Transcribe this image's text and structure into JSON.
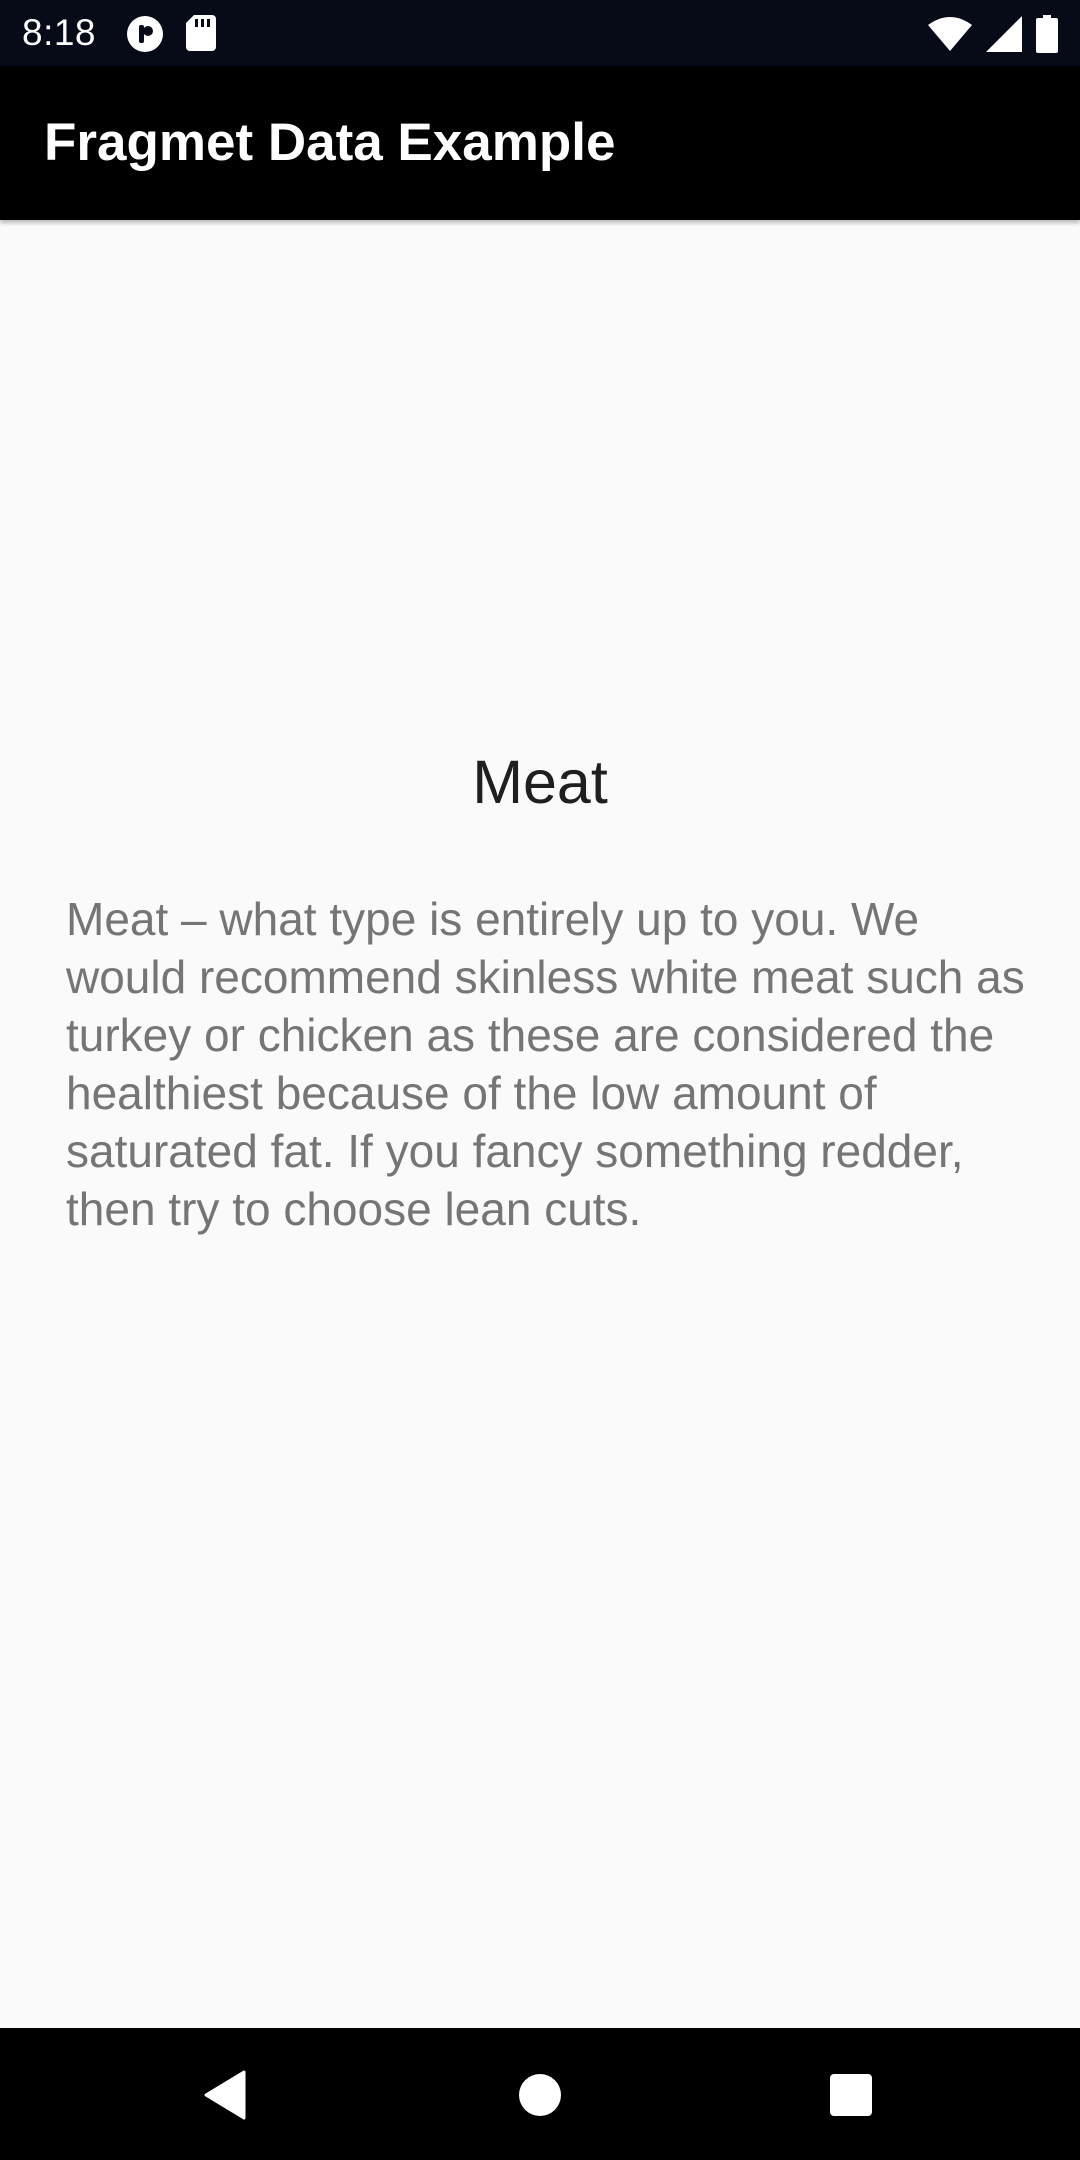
{
  "status_bar": {
    "time": "8:18",
    "icons_left": [
      "data-saver-icon",
      "sd-card-icon"
    ],
    "icons_right": [
      "wifi-icon",
      "cellular-signal-icon",
      "battery-icon"
    ]
  },
  "app_bar": {
    "title": "Fragmet Data Example"
  },
  "content": {
    "heading": "Meat",
    "description": "Meat – what type is entirely up to you. We would recommend skinless white meat such as turkey or chicken as these are considered the healthiest because of the low amount of saturated fat. If you fancy something redder, then try to choose lean cuts."
  },
  "nav_bar": {
    "buttons": [
      "back-icon",
      "home-icon",
      "recents-icon"
    ]
  },
  "colors": {
    "status_bar_bg": "#070a17",
    "app_bar_bg": "#000000",
    "page_bg": "#fafafa",
    "heading_text": "#1f1f1f",
    "body_text": "#757575"
  }
}
